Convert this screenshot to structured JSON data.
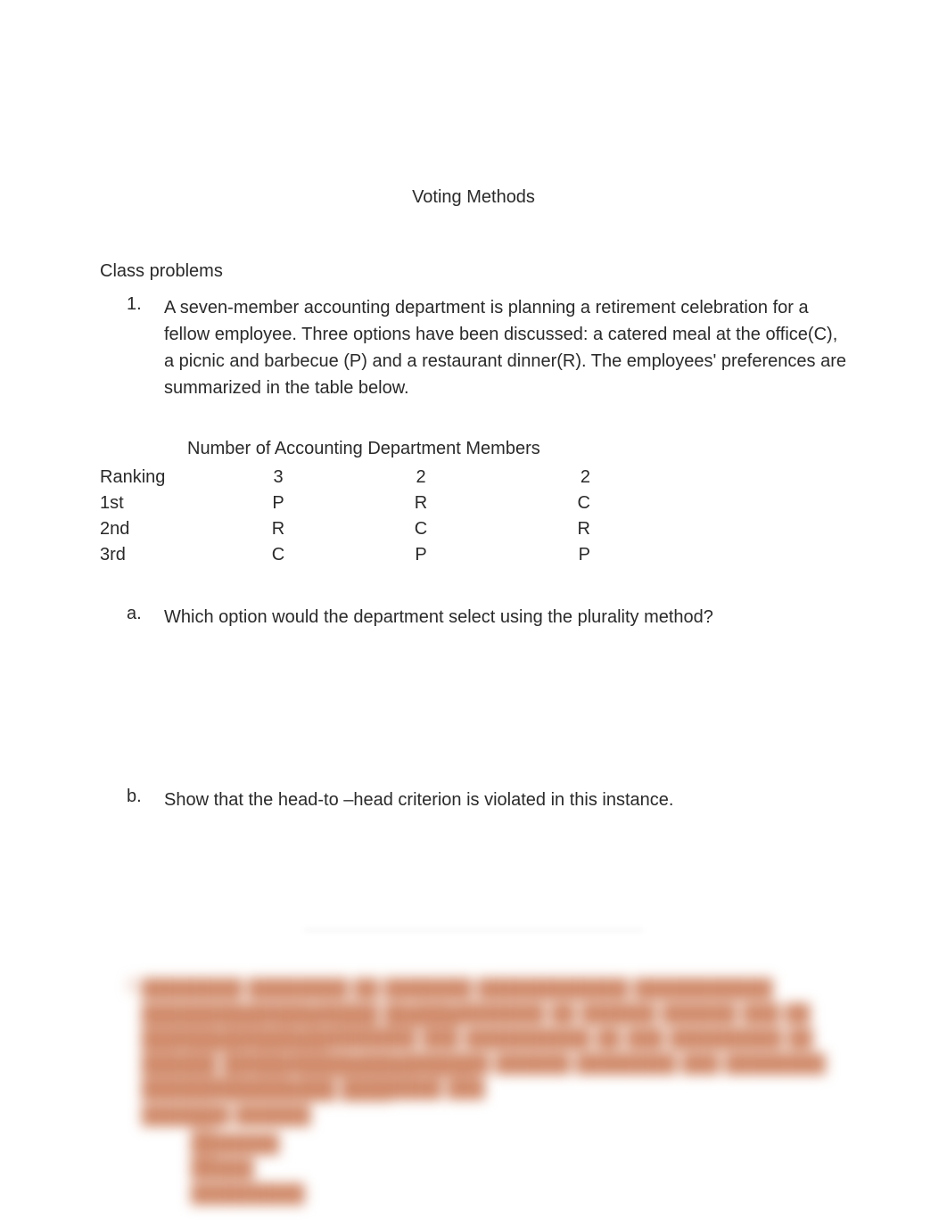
{
  "title": "Voting Methods",
  "section_label": "Class problems",
  "problems": [
    {
      "number": "1.",
      "text": "A seven-member accounting department is planning a retirement celebration for a fellow employee.  Three options have been discussed: a catered meal at the office(C), a picnic and barbecue (P) and a restaurant dinner(R).  The employees' preferences are summarized in the table below.",
      "table": {
        "caption": "Number of Accounting Department Members",
        "row_header_label": "Ranking",
        "columns": [
          "3",
          "2",
          "2"
        ],
        "rows": [
          {
            "rank": "1st",
            "cells": [
              "P",
              "R",
              "C"
            ]
          },
          {
            "rank": "2nd",
            "cells": [
              "R",
              "C",
              "R"
            ]
          },
          {
            "rank": "3rd",
            "cells": [
              "C",
              "P",
              "P"
            ]
          }
        ]
      },
      "subparts": [
        {
          "letter": "a.",
          "text": "Which option would the department select using the plurality method?"
        },
        {
          "letter": "b.",
          "text": "Show that the head-to –head criterion is violated in this instance."
        }
      ]
    }
  ],
  "hidden_problem_number": "2."
}
